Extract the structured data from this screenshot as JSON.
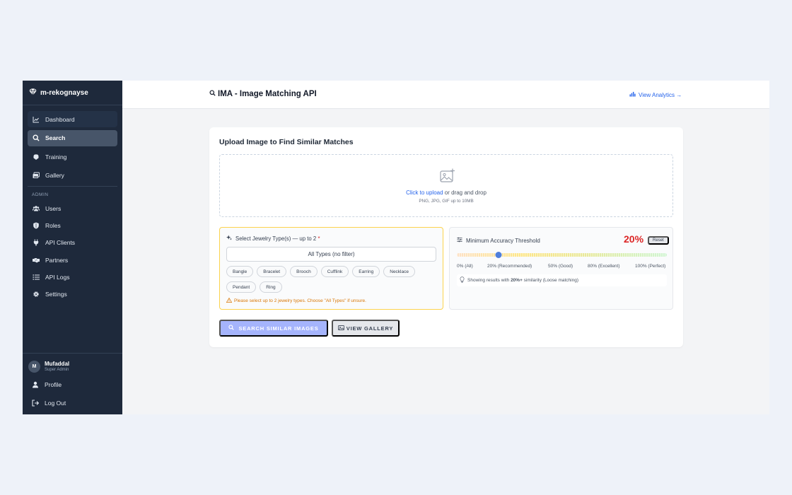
{
  "app": {
    "brand": "m-rekognayse"
  },
  "sidebar": {
    "nav": [
      {
        "label": "Dashboard",
        "icon": "chart-line-icon"
      },
      {
        "label": "Search",
        "icon": "search-icon",
        "active": true
      },
      {
        "label": "Training",
        "icon": "brain-icon"
      },
      {
        "label": "Gallery",
        "icon": "images-icon"
      }
    ],
    "admin_label": "ADMIN",
    "admin": [
      {
        "label": "Users",
        "icon": "users-icon"
      },
      {
        "label": "Roles",
        "icon": "shield-icon"
      },
      {
        "label": "API Clients",
        "icon": "plug-icon"
      },
      {
        "label": "Partners",
        "icon": "handshake-icon"
      },
      {
        "label": "API Logs",
        "icon": "list-icon"
      },
      {
        "label": "Settings",
        "icon": "gear-icon"
      }
    ],
    "user": {
      "initial": "M",
      "name": "Mufaddal",
      "role": "Super Admin"
    },
    "profile_label": "Profile",
    "logout_label": "Log Out"
  },
  "header": {
    "title": "IMA - Image Matching API",
    "analytics_link": "View Analytics →"
  },
  "upload": {
    "title": "Upload Image to Find Similar Matches",
    "click_text": "Click to upload",
    "drag_text": " or drag and drop",
    "hint": "PNG, JPG, GIF up to 10MB"
  },
  "jewelry": {
    "label": "Select Jewelry Type(s) — up to 2",
    "required_mark": "*",
    "all_types": "All Types (no filter)",
    "types": [
      "Bangle",
      "Bracelet",
      "Brooch",
      "Cufflink",
      "Earring",
      "Necklace",
      "Pendant",
      "Ring"
    ],
    "warning": "Please select up to 2 jewelry types. Choose \"All Types\" if unsure."
  },
  "accuracy": {
    "label": "Minimum Accuracy Threshold",
    "value_text": "20%",
    "value": 20,
    "reset_label": "Reset",
    "scale": [
      "0% (All)",
      "20% (Recommended)",
      "50% (Good)",
      "80% (Excellent)",
      "100% (Perfect)"
    ],
    "info_prefix": "Showing results with ",
    "info_bold": "20%+",
    "info_suffix": " similarity (Loose matching)"
  },
  "actions": {
    "search_label": "SEARCH SIMILAR IMAGES",
    "gallery_label": "VIEW GALLERY"
  },
  "colors": {
    "sidebar_bg": "#1e293b",
    "accent": "#2563eb",
    "threshold": "#dc2626",
    "search_btn": "#a5b4fc"
  }
}
